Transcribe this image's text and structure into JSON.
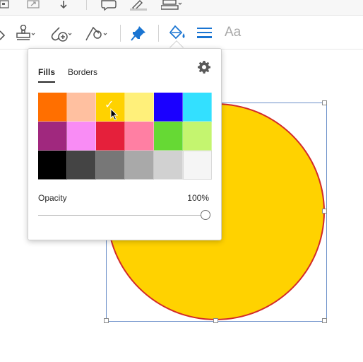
{
  "toolbar_top": {
    "icons": [
      "page-thumbnail-icon",
      "expand-icon",
      "download-arrow-icon",
      "comment-icon",
      "highlight-pen-icon",
      "stamp-icon"
    ]
  },
  "toolbar_main": {
    "tools": [
      "eraser-icon",
      "stamp-tool-icon",
      "attach-file-icon",
      "shapes-tool-icon",
      "pin-icon",
      "fill-color-icon",
      "line-style-icon"
    ],
    "text_tool_label": "Aa",
    "accent_color": "#1a75d2"
  },
  "popover": {
    "tabs": [
      {
        "label": "Fills",
        "active": true
      },
      {
        "label": "Borders",
        "active": false
      }
    ],
    "swatches": [
      "#ff6f00",
      "#ffc0a0",
      "#ffd200",
      "#fff07a",
      "#1a00ff",
      "#33e0ff",
      "#a0287e",
      "#f98cf5",
      "#e5203b",
      "#ff7fa3",
      "#66d934",
      "#c4f56f",
      "#000000",
      "#444444",
      "#777777",
      "#a9a9a9",
      "#d1d1d1",
      "#f5f5f5"
    ],
    "selected_swatch_index": 2,
    "opacity_label": "Opacity",
    "opacity_value": "100%",
    "opacity_fraction": 1.0
  },
  "canvas": {
    "shape": "circle",
    "fill_color": "#ffd200",
    "border_color": "#d22a2a",
    "selection_color": "#6b8fc9"
  }
}
